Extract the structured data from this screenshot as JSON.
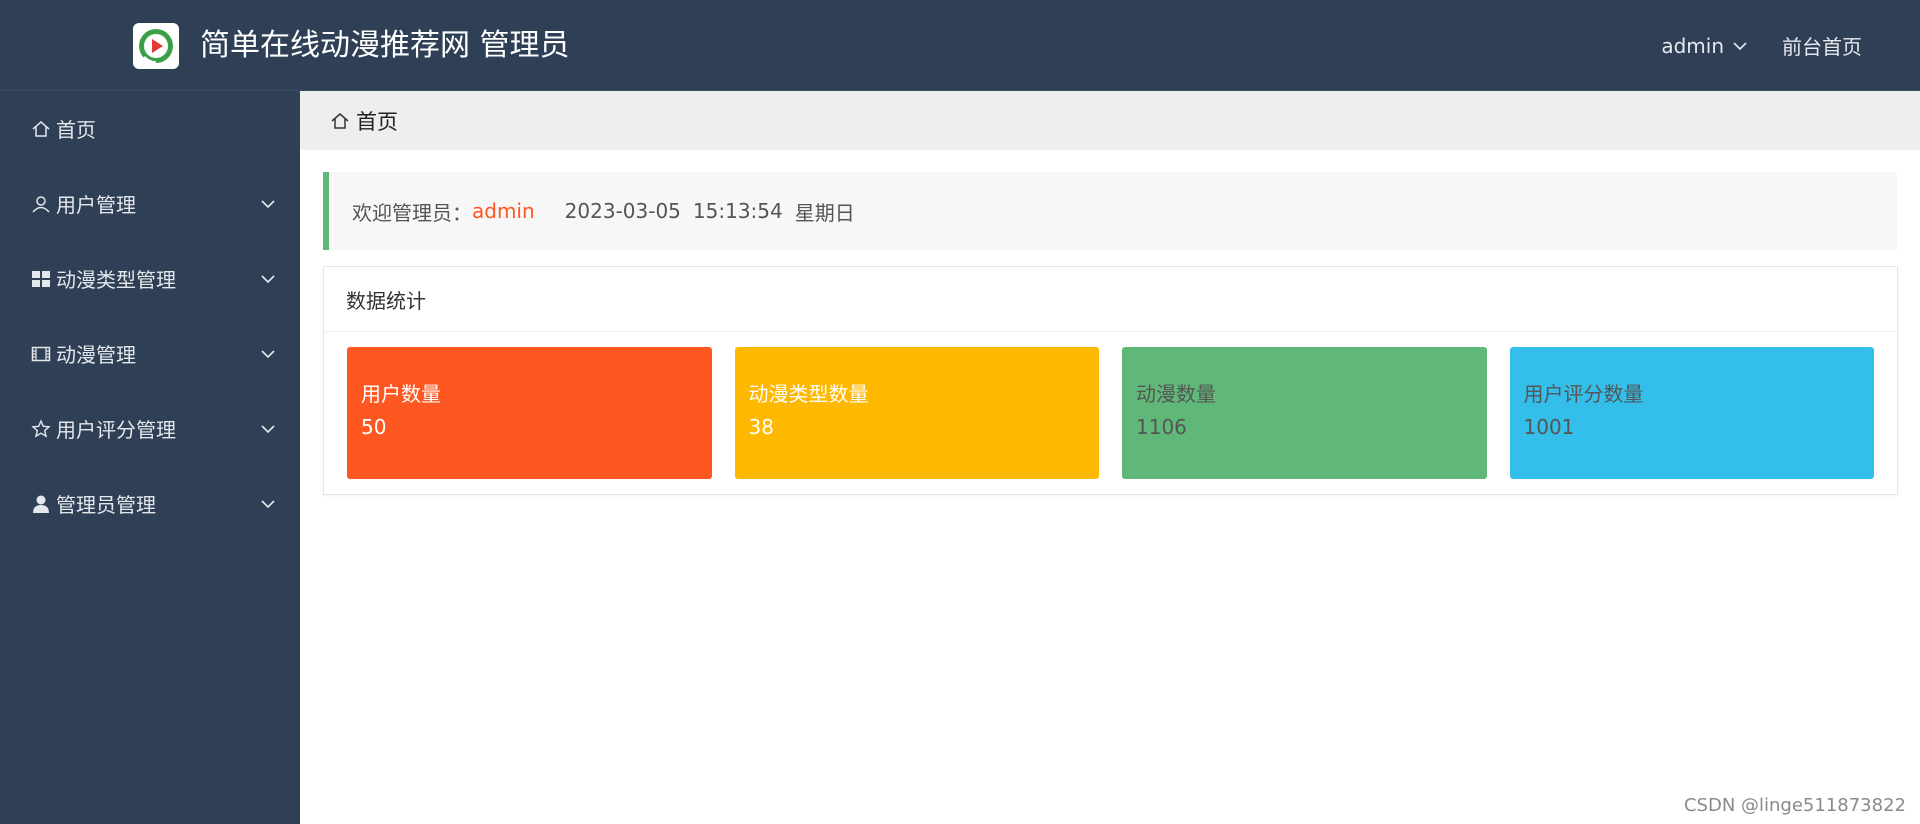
{
  "header": {
    "title": "简单在线动漫推荐网 管理员",
    "user": "admin",
    "front_link": "前台首页",
    "bg_color": "#2f4056"
  },
  "sidebar": {
    "items": [
      {
        "label": "首页",
        "icon": "home-icon",
        "expandable": false
      },
      {
        "label": "用户管理",
        "icon": "user-outline-icon",
        "expandable": true
      },
      {
        "label": "动漫类型管理",
        "icon": "grid-icon",
        "expandable": true
      },
      {
        "label": "动漫管理",
        "icon": "film-icon",
        "expandable": true
      },
      {
        "label": "用户评分管理",
        "icon": "star-icon",
        "expandable": true
      },
      {
        "label": "管理员管理",
        "icon": "user-solid-icon",
        "expandable": true
      }
    ]
  },
  "breadcrumb": {
    "label": "首页",
    "icon": "home-icon"
  },
  "welcome": {
    "prefix": "欢迎管理员：",
    "admin": "admin",
    "date": "2023-03-05",
    "time": "15:13:54",
    "weekday": "星期日",
    "accent_color": "#5fb878",
    "name_color": "#ff5722"
  },
  "stats": {
    "title": "数据统计",
    "tiles": [
      {
        "label": "用户数量",
        "value": "50",
        "color": "#ff5722"
      },
      {
        "label": "动漫类型数量",
        "value": "38",
        "color": "#ffb800"
      },
      {
        "label": "动漫数量",
        "value": "1106",
        "color": "#5fb878"
      },
      {
        "label": "用户评分数量",
        "value": "1001",
        "color": "#33bfea"
      }
    ]
  },
  "watermark": "CSDN @linge511873822"
}
